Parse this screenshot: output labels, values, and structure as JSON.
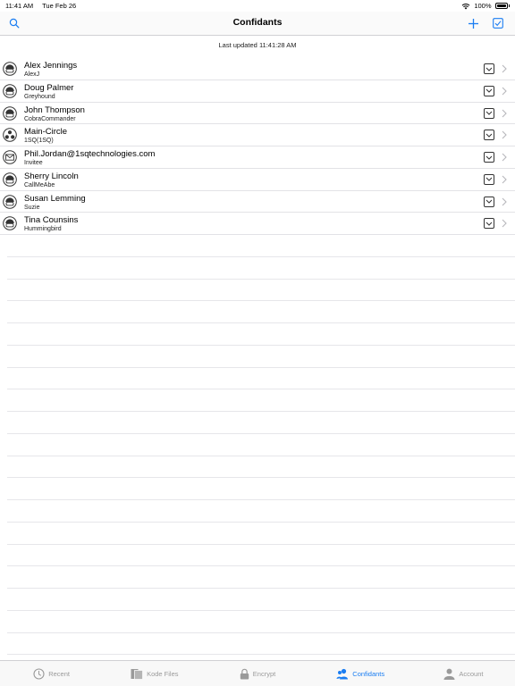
{
  "status": {
    "time": "11:41 AM",
    "date": "Tue Feb 26",
    "battery": "100%"
  },
  "nav": {
    "title": "Confidants"
  },
  "last_updated": "Last updated 11:41:28 AM",
  "contacts": [
    {
      "name": "Alex Jennings",
      "subtitle": "AlexJ",
      "icon": "person-avatar-icon"
    },
    {
      "name": "Doug Palmer",
      "subtitle": "Greyhound",
      "icon": "person-avatar-icon"
    },
    {
      "name": "John Thompson",
      "subtitle": "CobraCommander",
      "icon": "person-avatar-icon"
    },
    {
      "name": "Main-Circle",
      "subtitle": "1SQ(1SQ)",
      "icon": "group-avatar-icon"
    },
    {
      "name": "Phil.Jordan@1sqtechnologies.com",
      "subtitle": "Invitee",
      "icon": "envelope-icon"
    },
    {
      "name": "Sherry Lincoln",
      "subtitle": "CallMeAbe",
      "icon": "person-avatar-icon"
    },
    {
      "name": "Susan Lemming",
      "subtitle": "Suzie",
      "icon": "person-avatar-icon"
    },
    {
      "name": "Tina Counsins",
      "subtitle": "Hummingbird",
      "icon": "person-avatar-icon"
    }
  ],
  "tabs": [
    {
      "label": "Recent",
      "icon": "clock-icon",
      "active": false
    },
    {
      "label": "Kode Files",
      "icon": "files-icon",
      "active": false
    },
    {
      "label": "Encrypt",
      "icon": "lock-icon",
      "active": false
    },
    {
      "label": "Confidants",
      "icon": "confidants-icon",
      "active": true
    },
    {
      "label": "Account",
      "icon": "account-icon",
      "active": false
    }
  ],
  "colors": {
    "accent": "#1a7df2",
    "inactive": "#9a9a9a"
  }
}
